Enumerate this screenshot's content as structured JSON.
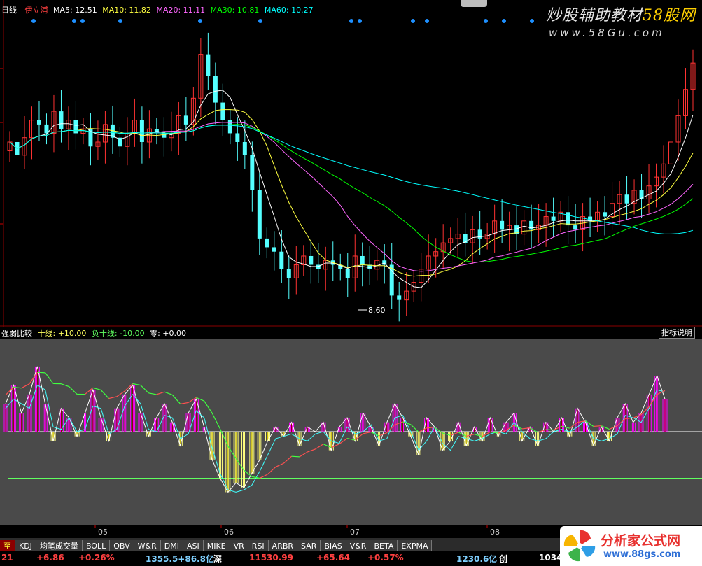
{
  "main": {
    "label": "日线",
    "stock_name": "伊立浦",
    "ma": [
      {
        "label": "MA5: 12.51",
        "color": "#ffffff"
      },
      {
        "label": "MA10: 11.82",
        "color": "#ffff40"
      },
      {
        "label": "MA20: 11.11",
        "color": "#ff66ff"
      },
      {
        "label": "MA30: 10.81",
        "color": "#00ff00"
      },
      {
        "label": "MA60: 10.27",
        "color": "#00ffff"
      }
    ],
    "low_label": "8.60",
    "watermark_text": "炒股辅助教材",
    "watermark_brand": "58股网",
    "watermark_url": "www.58Gu.com"
  },
  "indicator": {
    "name": "强弱比较",
    "line1": "十线: +10.00",
    "line2": "负十线: -10.00",
    "line3": "零: +0.00",
    "help_button": "指标说明"
  },
  "axis": {
    "months": [
      "05",
      "06",
      "07",
      "08"
    ]
  },
  "tabs": [
    "KDJ",
    "均笔成交量",
    "BOLL",
    "OBV",
    "W&R",
    "DMI",
    "ASI",
    "MIKE",
    "VR",
    "RSI",
    "ARBR",
    "SAR",
    "BIAS",
    "V&R",
    "BETA",
    "EXPMA"
  ],
  "tab_prefix": "至",
  "status": {
    "s1": "21",
    "s2": "+6.86",
    "s3": "+0.26%",
    "s4": "1355.5+86.8亿",
    "s5": "深",
    "s6": "11530.99",
    "s7": "+65.64",
    "s8": "+0.57%",
    "s9": "1230.6亿",
    "s10": "创",
    "s11": "1034"
  },
  "logo": {
    "text": "分析家公式网",
    "url": "www.88gs.com"
  },
  "colors": {
    "up": "#ff3232",
    "down": "#54ffff",
    "ma5": "#ffffff",
    "ma10": "#ffff40",
    "ma20": "#ff66ff",
    "ma30": "#00ff00",
    "ma60": "#00ffff",
    "ind_pos": "#ff00ff",
    "ind_neg": "#ffff80"
  },
  "chart_data": [
    {
      "type": "candlestick",
      "title": "",
      "series": [
        {
          "name": "MA5",
          "value": 12.51
        },
        {
          "name": "MA10",
          "value": 11.82
        },
        {
          "name": "MA20",
          "value": 11.11
        },
        {
          "name": "MA30",
          "value": 10.81
        },
        {
          "name": "MA60",
          "value": 10.27
        }
      ],
      "x_ticks": [
        "05",
        "06",
        "07",
        "08"
      ],
      "annotation_low": 8.6,
      "close_path": [
        12.4,
        12.1,
        12.5,
        12.9,
        12.8,
        12.6,
        13.1,
        12.7,
        12.9,
        12.6,
        12.7,
        12.3,
        12.4,
        12.8,
        12.5,
        12.3,
        12.6,
        12.9,
        12.4,
        12.7,
        12.6,
        12.5,
        12.6,
        13.0,
        12.8,
        13.4,
        14.4,
        13.9,
        13.3,
        12.9,
        12.6,
        12.4,
        12.1,
        11.3,
        10.2,
        10.0,
        9.9,
        9.5,
        9.3,
        9.6,
        9.8,
        9.6,
        9.5,
        9.7,
        9.6,
        9.5,
        9.3,
        9.8,
        9.6,
        9.5,
        9.7,
        9.6,
        8.9,
        8.8,
        9.0,
        9.2,
        9.5,
        9.8,
        9.9,
        10.1,
        10.2,
        10.3,
        10.1,
        10.4,
        10.2,
        10.3,
        10.6,
        10.4,
        10.5,
        10.3,
        10.6,
        10.4,
        10.5,
        10.7,
        10.6,
        10.8,
        10.5,
        10.4,
        10.7,
        10.6,
        10.8,
        10.7,
        11.0,
        11.2,
        11.0,
        11.3,
        11.1,
        11.4,
        11.6,
        11.9,
        12.4,
        13.0,
        13.6,
        14.2
      ]
    },
    {
      "type": "line",
      "title": "",
      "reference_lines": [
        10,
        -10,
        0
      ],
      "values": [
        6,
        10,
        4,
        8,
        14,
        6,
        -2,
        5,
        3,
        -1,
        4,
        9,
        3,
        -2,
        5,
        8,
        10,
        4,
        -1,
        3,
        6,
        2,
        -3,
        4,
        7,
        1,
        -6,
        -10,
        -13,
        -11,
        -12,
        -9,
        -6,
        -2,
        1,
        -1,
        2,
        -3,
        1,
        0,
        2,
        -4,
        1,
        3,
        -2,
        4,
        1,
        -3,
        2,
        6,
        3,
        -1,
        -5,
        3,
        1,
        -4,
        -2,
        2,
        -3,
        1,
        -2,
        3,
        -1,
        2,
        4,
        -2,
        1,
        -3,
        2,
        0,
        3,
        -1,
        5,
        2,
        -3,
        1,
        -2,
        3,
        6,
        2,
        4,
        8,
        12,
        7
      ],
      "ylim": [
        -20,
        20
      ]
    }
  ]
}
